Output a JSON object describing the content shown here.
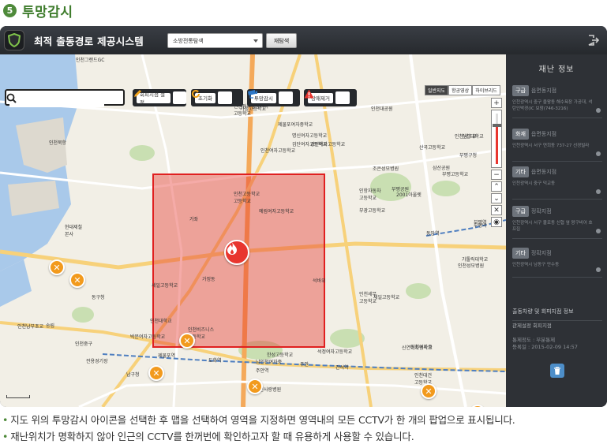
{
  "section": {
    "number": "5",
    "title": "투망감시"
  },
  "app": {
    "title": "최적 출동경로 제공시스템",
    "mode_select": "소방전통탐색",
    "search_button": "재탐색"
  },
  "toolbar": {
    "search_placeholder": "",
    "buttons": [
      {
        "label": "회피지점 설정",
        "icon": "pencil-icon"
      },
      {
        "label": "초기화",
        "icon": "refresh-icon"
      },
      {
        "label": "투망감시",
        "icon": "cctv-icon"
      },
      {
        "label": "장애제거",
        "icon": "warning-icon"
      }
    ]
  },
  "map_types": [
    "일반지도",
    "항공영상",
    "하이브리드"
  ],
  "map_labels": [
    "인천그랜드GC",
    "인천북항",
    "현대제철",
    "본사",
    "세일고등학교",
    "인천정석항공과학",
    "고등학교",
    "제물포여자중학교",
    "인천여자고등학교",
    "동구청",
    "인천남부초교",
    "인천대학교",
    "박문여자고등학교",
    "인천중구",
    "전용경기장",
    "남구청",
    "인천비즈니스",
    "고등학교",
    "인천사랑병원",
    "한성고등학교",
    "남인천여자중",
    "석정여자고등학교",
    "인천세무",
    "고등학교",
    "제일고등학교",
    "인천여자중",
    "인천대건",
    "고등학교",
    "조은성모병원",
    "부평공원",
    "인항자동차",
    "고등학교",
    "부광고등학교",
    "인천남고교",
    "부평구청",
    "산곡고등학교",
    "부평고등학교",
    "가톨릭대학교",
    "인천성모병원",
    "2001아울렛",
    "신연여자중학교",
    "인천대학교",
    "부평역",
    "검단여자고등학교",
    "가정고등학교",
    "인천고등학교",
    "고등학교",
    "삼산공원",
    "동암역",
    "제물포역",
    "도화역",
    "주안역",
    "간석역",
    "주안",
    "부평역",
    "경인여자고등학교",
    "명신여자고등학교",
    "석바위",
    "가좌",
    "예림여자고등학교",
    "가정동",
    "인천대공원",
    "송림"
  ],
  "panel": {
    "title": "재난 정보",
    "items": [
      {
        "tag": "구급",
        "location": "읍면동지점",
        "address": "인천광역시 중구 을왕동 해수욕장 가공대, 석탄인박경(IC 보람(746-3216)"
      },
      {
        "tag": "화재",
        "location": "읍면동지점",
        "address": "인천광역시 서구 연희동 737-27 선경빌라"
      },
      {
        "tag": "기타",
        "location": "읍면동지점",
        "address": "인천광역시 중구 덕교동"
      },
      {
        "tag": "구급",
        "location": "정확지점",
        "address": "인천광역시 서구 불로동 신협 옆 왕구비어 호프집"
      },
      {
        "tag": "기타",
        "location": "정확지점",
        "address": "인천광역시 남동구 만수동"
      }
    ],
    "route_title": "출동차량 및 회피지점 정보",
    "route_sub": "관제설정 회피지점",
    "route_info_1": "통제정도 : 부분통제",
    "route_info_2": "등록일 : 2015-02-09 14:57"
  },
  "notes": [
    "지도 위의 투망감시 아이콘을 선택한 후 맵을 선택하여 영역을 지정하면 영역내의 모든 CCTV가 한 개의 팝업으로 표시됩니다.",
    "재난위치가 명확하지 않아 인근의 CCTV를 한꺼번에 확인하고자 할 때 유용하게 사용할 수 있습니다."
  ],
  "colors": {
    "accent": "#4e8a3a",
    "selection": "#e8362f",
    "panel": "#2e3136"
  }
}
